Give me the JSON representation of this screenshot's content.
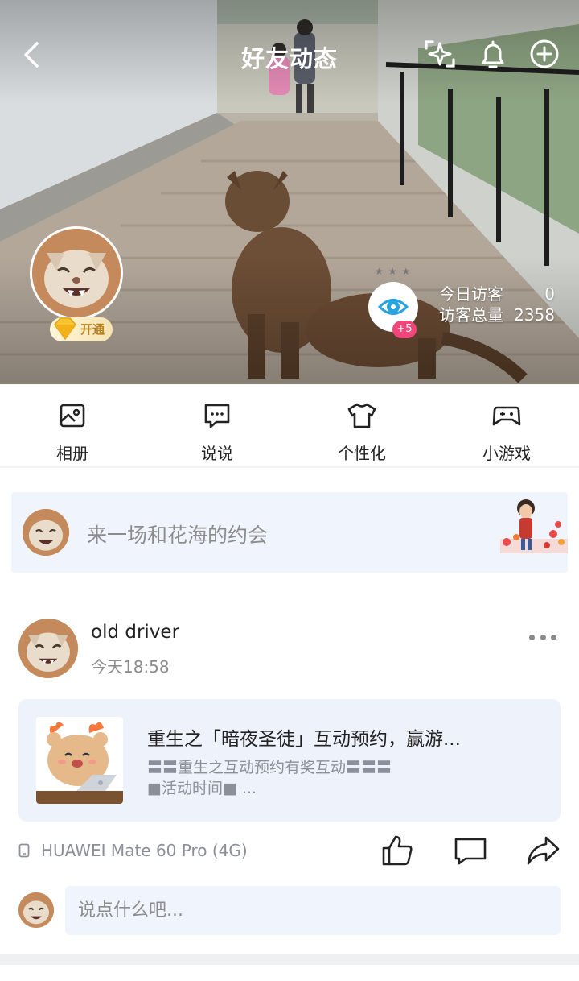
{
  "header": {
    "title": "好友动态",
    "icons": [
      "back-icon",
      "sparkle-icon",
      "bell-icon",
      "add-icon"
    ]
  },
  "profile": {
    "vip_label": "开通",
    "visitor_plus": "+5",
    "today_visitors_label": "今日访客",
    "today_visitors": "0",
    "total_visitors_label": "访客总量",
    "total_visitors": "2358"
  },
  "quick_nav": [
    {
      "label": "相册",
      "icon": "photo-album-icon"
    },
    {
      "label": "说说",
      "icon": "chat-bubble-icon"
    },
    {
      "label": "个性化",
      "icon": "tshirt-icon"
    },
    {
      "label": "小游戏",
      "icon": "gamepad-icon"
    }
  ],
  "compose": {
    "placeholder": "来一场和花海的约会"
  },
  "post": {
    "username": "old driver",
    "time": "今天18:58",
    "card_title": "重生之「暗夜圣徒」互动预约，赢游...",
    "card_desc_line1": "〓〓重生之互动预约有奖互动〓〓〓",
    "card_desc_line2": "■活动时间■  ...",
    "device": "HUAWEI Mate 60 Pro (4G)"
  },
  "reply": {
    "placeholder": "说点什么吧..."
  },
  "colors": {
    "accent_pink": "#f0467a",
    "compose_bg": "#f0f4fc",
    "muted_text": "#8c8c8c",
    "eye_blue": "#29a3e0"
  }
}
